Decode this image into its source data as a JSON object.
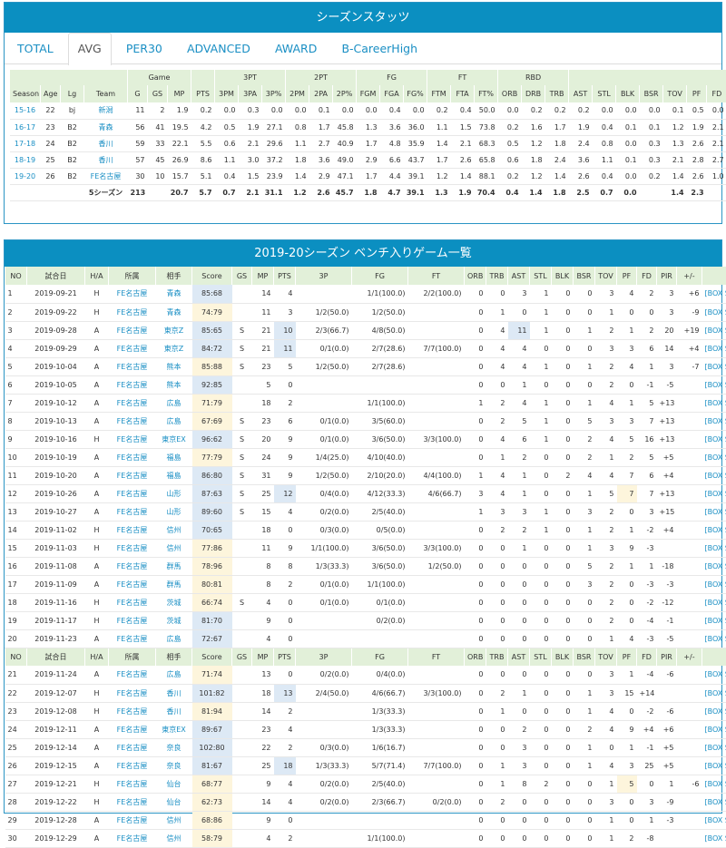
{
  "season_panel": {
    "title": "シーズンスタッツ",
    "tabs": [
      "TOTAL",
      "AVG",
      "PER30",
      "ADVANCED",
      "AWARD",
      "B-CareerHigh"
    ],
    "active_tab": "AVG",
    "group_headers": [
      "Game",
      "3PT",
      "2PT",
      "FG",
      "FT",
      "RBD"
    ],
    "columns": [
      "Season",
      "Age",
      "Lg",
      "Team",
      "G",
      "GS",
      "MP",
      "PTS",
      "3PM",
      "3PA",
      "3P%",
      "2PM",
      "2PA",
      "2P%",
      "FGM",
      "FGA",
      "FG%",
      "FTM",
      "FTA",
      "FT%",
      "ORB",
      "DRB",
      "TRB",
      "AST",
      "STL",
      "BLK",
      "BSR",
      "TOV",
      "PF",
      "FD"
    ],
    "rows": [
      [
        "15-16",
        "22",
        "bj",
        "新潟",
        "11",
        "2",
        "1.9",
        "0.2",
        "0.0",
        "0.3",
        "0.0",
        "0.0",
        "0.1",
        "0.0",
        "0.0",
        "0.4",
        "0.0",
        "0.2",
        "0.4",
        "50.0",
        "0.0",
        "0.2",
        "0.2",
        "0.2",
        "0.0",
        "0.0",
        "0.0",
        "0.1",
        "0.5",
        "0.0"
      ],
      [
        "16-17",
        "23",
        "B2",
        "青森",
        "56",
        "41",
        "19.5",
        "4.2",
        "0.5",
        "1.9",
        "27.1",
        "0.8",
        "1.7",
        "45.8",
        "1.3",
        "3.6",
        "36.0",
        "1.1",
        "1.5",
        "73.8",
        "0.2",
        "1.6",
        "1.7",
        "1.9",
        "0.4",
        "0.1",
        "0.1",
        "1.2",
        "1.9",
        "2.1"
      ],
      [
        "17-18",
        "24",
        "B2",
        "香川",
        "59",
        "33",
        "22.1",
        "5.5",
        "0.6",
        "2.1",
        "29.6",
        "1.1",
        "2.7",
        "40.9",
        "1.7",
        "4.8",
        "35.9",
        "1.4",
        "2.1",
        "68.3",
        "0.5",
        "1.2",
        "1.8",
        "2.4",
        "0.8",
        "0.0",
        "0.3",
        "1.3",
        "2.6",
        "2.1"
      ],
      [
        "18-19",
        "25",
        "B2",
        "香川",
        "57",
        "45",
        "26.9",
        "8.6",
        "1.1",
        "3.0",
        "37.2",
        "1.8",
        "3.6",
        "49.0",
        "2.9",
        "6.6",
        "43.7",
        "1.7",
        "2.6",
        "65.8",
        "0.6",
        "1.8",
        "2.4",
        "3.6",
        "1.1",
        "0.1",
        "0.3",
        "2.1",
        "2.8",
        "2.7"
      ],
      [
        "19-20",
        "26",
        "B2",
        "FE名古屋",
        "30",
        "10",
        "15.7",
        "5.1",
        "0.4",
        "1.5",
        "23.9",
        "1.4",
        "2.9",
        "47.1",
        "1.7",
        "4.4",
        "39.1",
        "1.2",
        "1.4",
        "88.1",
        "0.2",
        "1.2",
        "1.4",
        "2.6",
        "0.4",
        "0.0",
        "0.2",
        "1.4",
        "2.6",
        "1.0"
      ]
    ],
    "total_row": [
      "",
      "",
      "",
      "5シーズン",
      "213",
      "",
      "20.7",
      "5.7",
      "0.7",
      "2.1",
      "31.1",
      "1.2",
      "2.6",
      "45.7",
      "1.8",
      "4.7",
      "39.1",
      "1.3",
      "1.9",
      "70.4",
      "0.4",
      "1.4",
      "1.8",
      "2.5",
      "0.7",
      "0.0",
      "",
      "1.4",
      "2.3",
      ""
    ]
  },
  "games_panel": {
    "title": "2019-20シーズン ベンチ入りゲーム一覧",
    "columns": [
      "NO",
      "試合日",
      "H/A",
      "所属",
      "相手",
      "Score",
      "GS",
      "MP",
      "PTS",
      "3P",
      "FG",
      "FT",
      "ORB",
      "TRB",
      "AST",
      "STL",
      "BLK",
      "BSR",
      "TOV",
      "PF",
      "FD",
      "PIR",
      "+/-",
      ""
    ],
    "link_label": "[BOX SCORE]",
    "rows": [
      [
        "1",
        "2019-09-21",
        "H",
        "FE名古屋",
        "青森",
        "85:68",
        "",
        "14",
        "4",
        "",
        "1/1(100.0)",
        "2/2(100.0)",
        "0",
        "0",
        "3",
        "1",
        "0",
        "0",
        "3",
        "4",
        "2",
        "3",
        "+6"
      ],
      [
        "2",
        "2019-09-22",
        "H",
        "FE名古屋",
        "青森",
        "74:79",
        "",
        "11",
        "3",
        "1/2(50.0)",
        "1/2(50.0)",
        "",
        "0",
        "1",
        "0",
        "1",
        "0",
        "0",
        "1",
        "0",
        "0",
        "3",
        "-9"
      ],
      [
        "3",
        "2019-09-28",
        "A",
        "FE名古屋",
        "東京Z",
        "85:65",
        "S",
        "21",
        "10",
        "2/3(66.7)",
        "4/8(50.0)",
        "",
        "0",
        "4",
        "11",
        "1",
        "0",
        "1",
        "2",
        "1",
        "2",
        "20",
        "+19"
      ],
      [
        "4",
        "2019-09-29",
        "A",
        "FE名古屋",
        "東京Z",
        "84:72",
        "S",
        "21",
        "11",
        "0/1(0.0)",
        "2/7(28.6)",
        "7/7(100.0)",
        "0",
        "4",
        "4",
        "0",
        "0",
        "0",
        "3",
        "3",
        "6",
        "14",
        "+4"
      ],
      [
        "5",
        "2019-10-04",
        "A",
        "FE名古屋",
        "熊本",
        "85:88",
        "S",
        "23",
        "5",
        "1/2(50.0)",
        "2/7(28.6)",
        "",
        "0",
        "4",
        "4",
        "1",
        "0",
        "1",
        "2",
        "4",
        "1",
        "3",
        "-7"
      ],
      [
        "6",
        "2019-10-05",
        "A",
        "FE名古屋",
        "熊本",
        "92:85",
        "",
        "5",
        "0",
        "",
        "",
        "",
        "0",
        "0",
        "1",
        "0",
        "0",
        "0",
        "2",
        "0",
        "-1",
        "-5",
        ""
      ],
      [
        "7",
        "2019-10-12",
        "A",
        "FE名古屋",
        "広島",
        "71:79",
        "",
        "18",
        "2",
        "",
        "1/1(100.0)",
        "",
        "1",
        "2",
        "4",
        "1",
        "0",
        "1",
        "4",
        "1",
        "5",
        "+13",
        ""
      ],
      [
        "8",
        "2019-10-13",
        "A",
        "FE名古屋",
        "広島",
        "67:69",
        "S",
        "23",
        "6",
        "0/1(0.0)",
        "3/5(60.0)",
        "",
        "0",
        "2",
        "5",
        "1",
        "0",
        "5",
        "3",
        "3",
        "7",
        "+13",
        ""
      ],
      [
        "9",
        "2019-10-16",
        "H",
        "FE名古屋",
        "東京EX",
        "96:62",
        "S",
        "20",
        "9",
        "0/1(0.0)",
        "3/6(50.0)",
        "3/3(100.0)",
        "0",
        "4",
        "6",
        "1",
        "0",
        "2",
        "4",
        "5",
        "16",
        "+13",
        ""
      ],
      [
        "10",
        "2019-10-19",
        "A",
        "FE名古屋",
        "福島",
        "77:79",
        "S",
        "24",
        "9",
        "1/4(25.0)",
        "4/10(40.0)",
        "",
        "0",
        "1",
        "2",
        "0",
        "0",
        "2",
        "1",
        "2",
        "5",
        "+5",
        ""
      ],
      [
        "11",
        "2019-10-20",
        "A",
        "FE名古屋",
        "福島",
        "86:80",
        "S",
        "31",
        "9",
        "1/2(50.0)",
        "2/10(20.0)",
        "4/4(100.0)",
        "1",
        "4",
        "1",
        "0",
        "2",
        "4",
        "4",
        "7",
        "6",
        "+4",
        ""
      ],
      [
        "12",
        "2019-10-26",
        "A",
        "FE名古屋",
        "山形",
        "87:63",
        "S",
        "25",
        "12",
        "0/4(0.0)",
        "4/12(33.3)",
        "4/6(66.7)",
        "3",
        "4",
        "1",
        "0",
        "0",
        "1",
        "5",
        "7",
        "7",
        "+13",
        ""
      ],
      [
        "13",
        "2019-10-27",
        "A",
        "FE名古屋",
        "山形",
        "89:60",
        "S",
        "15",
        "4",
        "0/2(0.0)",
        "2/5(40.0)",
        "",
        "1",
        "3",
        "3",
        "1",
        "0",
        "3",
        "2",
        "0",
        "3",
        "+15",
        ""
      ],
      [
        "14",
        "2019-11-02",
        "H",
        "FE名古屋",
        "信州",
        "70:65",
        "",
        "18",
        "0",
        "0/3(0.0)",
        "0/5(0.0)",
        "",
        "0",
        "2",
        "2",
        "1",
        "0",
        "1",
        "2",
        "1",
        "-2",
        "+4",
        ""
      ],
      [
        "15",
        "2019-11-03",
        "H",
        "FE名古屋",
        "信州",
        "77:86",
        "",
        "11",
        "9",
        "1/1(100.0)",
        "3/6(50.0)",
        "3/3(100.0)",
        "0",
        "0",
        "1",
        "0",
        "0",
        "1",
        "3",
        "9",
        "-3",
        ""
      ],
      [
        "16",
        "2019-11-08",
        "A",
        "FE名古屋",
        "群馬",
        "78:96",
        "",
        "8",
        "8",
        "1/3(33.3)",
        "3/6(50.0)",
        "1/2(50.0)",
        "0",
        "0",
        "0",
        "0",
        "0",
        "5",
        "2",
        "1",
        "1",
        "-18",
        ""
      ],
      [
        "17",
        "2019-11-09",
        "A",
        "FE名古屋",
        "群馬",
        "80:81",
        "",
        "8",
        "2",
        "0/1(0.0)",
        "1/1(100.0)",
        "",
        "0",
        "0",
        "0",
        "0",
        "0",
        "3",
        "2",
        "0",
        "-3",
        "-3",
        ""
      ],
      [
        "18",
        "2019-11-16",
        "H",
        "FE名古屋",
        "茨城",
        "66:74",
        "S",
        "4",
        "0",
        "0/1(0.0)",
        "0/1(0.0)",
        "",
        "0",
        "0",
        "0",
        "0",
        "0",
        "0",
        "2",
        "0",
        "-2",
        "-12",
        ""
      ],
      [
        "19",
        "2019-11-17",
        "H",
        "FE名古屋",
        "茨城",
        "81:70",
        "",
        "9",
        "0",
        "",
        "0/2(0.0)",
        "",
        "0",
        "0",
        "0",
        "0",
        "0",
        "0",
        "2",
        "0",
        "-4",
        "-1",
        ""
      ],
      [
        "20",
        "2019-11-23",
        "A",
        "FE名古屋",
        "広島",
        "72:67",
        "",
        "4",
        "0",
        "",
        "",
        "",
        "0",
        "0",
        "0",
        "0",
        "0",
        "0",
        "1",
        "4",
        "-3",
        "-5",
        ""
      ]
    ],
    "rows2": [
      [
        "21",
        "2019-11-24",
        "A",
        "FE名古屋",
        "広島",
        "71:74",
        "",
        "13",
        "0",
        "0/2(0.0)",
        "0/4(0.0)",
        "",
        "0",
        "0",
        "0",
        "0",
        "0",
        "0",
        "3",
        "1",
        "-4",
        "-6"
      ],
      [
        "22",
        "2019-12-07",
        "H",
        "FE名古屋",
        "香川",
        "101:82",
        "",
        "18",
        "13",
        "2/4(50.0)",
        "4/6(66.7)",
        "3/3(100.0)",
        "0",
        "2",
        "1",
        "0",
        "0",
        "1",
        "3",
        "15",
        "+14",
        ""
      ],
      [
        "23",
        "2019-12-08",
        "H",
        "FE名古屋",
        "香川",
        "81:94",
        "",
        "14",
        "2",
        "",
        "1/3(33.3)",
        "",
        "0",
        "1",
        "0",
        "0",
        "0",
        "1",
        "4",
        "0",
        "-2",
        "-6",
        ""
      ],
      [
        "24",
        "2019-12-11",
        "A",
        "FE名古屋",
        "東京EX",
        "89:67",
        "",
        "23",
        "4",
        "",
        "1/3(33.3)",
        "",
        "0",
        "0",
        "2",
        "0",
        "0",
        "2",
        "4",
        "9",
        "+4",
        "+6",
        ""
      ],
      [
        "25",
        "2019-12-14",
        "A",
        "FE名古屋",
        "奈良",
        "102:80",
        "",
        "22",
        "2",
        "0/3(0.0)",
        "1/6(16.7)",
        "",
        "0",
        "0",
        "3",
        "0",
        "0",
        "1",
        "0",
        "1",
        "-1",
        "+5",
        ""
      ],
      [
        "26",
        "2019-12-15",
        "A",
        "FE名古屋",
        "奈良",
        "81:67",
        "",
        "25",
        "18",
        "1/3(33.3)",
        "5/7(71.4)",
        "7/7(100.0)",
        "0",
        "1",
        "3",
        "0",
        "0",
        "1",
        "4",
        "3",
        "25",
        "+5",
        ""
      ],
      [
        "27",
        "2019-12-21",
        "H",
        "FE名古屋",
        "仙台",
        "68:77",
        "",
        "9",
        "4",
        "0/2(0.0)",
        "2/5(40.0)",
        "",
        "0",
        "1",
        "8",
        "2",
        "0",
        "0",
        "1",
        "5",
        "0",
        "1",
        "-6"
      ],
      [
        "28",
        "2019-12-22",
        "H",
        "FE名古屋",
        "仙台",
        "62:73",
        "",
        "14",
        "4",
        "0/2(0.0)",
        "2/3(66.7)",
        "0/2(0.0)",
        "0",
        "2",
        "0",
        "0",
        "0",
        "0",
        "3",
        "0",
        "3",
        "-9",
        ""
      ],
      [
        "29",
        "2019-12-28",
        "A",
        "FE名古屋",
        "信州",
        "68:86",
        "",
        "9",
        "0",
        "",
        "",
        "",
        "0",
        "0",
        "0",
        "0",
        "0",
        "0",
        "1",
        "0",
        "1",
        "-3",
        ""
      ],
      [
        "30",
        "2019-12-29",
        "A",
        "FE名古屋",
        "信州",
        "58:79",
        "",
        "4",
        "2",
        "",
        "1/1(100.0)",
        "",
        "0",
        "0",
        "0",
        "0",
        "0",
        "0",
        "1",
        "2",
        "-8",
        ""
      ]
    ]
  }
}
